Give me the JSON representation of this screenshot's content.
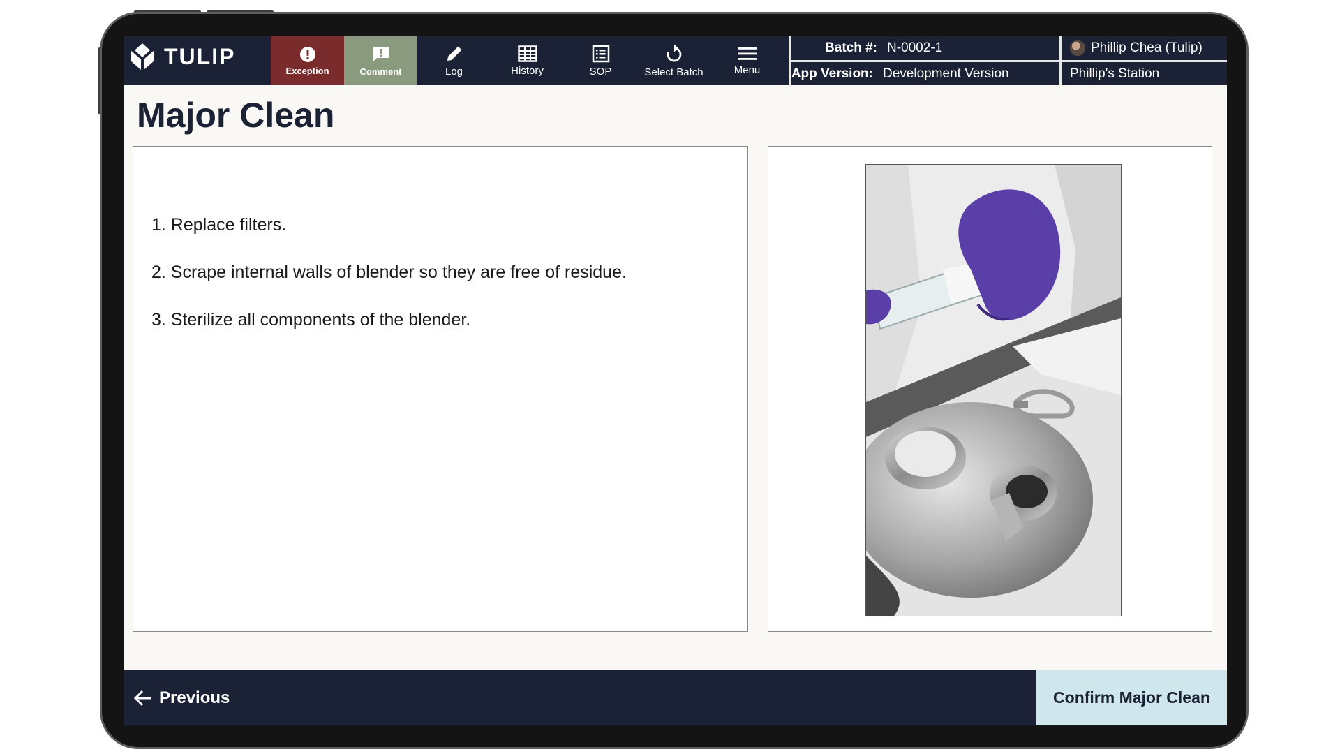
{
  "app": {
    "logo_text": "TULIP"
  },
  "toolbar": {
    "exception_label": "Exception",
    "comment_label": "Comment",
    "log_label": "Log",
    "history_label": "History",
    "sop_label": "SOP",
    "select_batch_label": "Select Batch",
    "menu_label": "Menu"
  },
  "info": {
    "batch_key": "Batch #:",
    "batch_value": "N-0002-1",
    "version_key": "App Version:",
    "version_value": "Development Version"
  },
  "user": {
    "name": "Phillip Chea (Tulip)",
    "station": "Phillip's Station"
  },
  "page": {
    "title": "Major Clean",
    "steps": [
      "1. Replace filters.",
      "2. Scrape internal walls of blender so they are free of residue.",
      "3. Sterilize all components of the blender."
    ]
  },
  "footer": {
    "previous_label": "Previous",
    "confirm_label": "Confirm Major Clean"
  },
  "colors": {
    "header_bg": "#1b2235",
    "exception_bg": "#7a2b2b",
    "comment_bg": "#8a9a7e",
    "confirm_bg": "#cfe6ec",
    "page_bg": "#faf8f5"
  }
}
